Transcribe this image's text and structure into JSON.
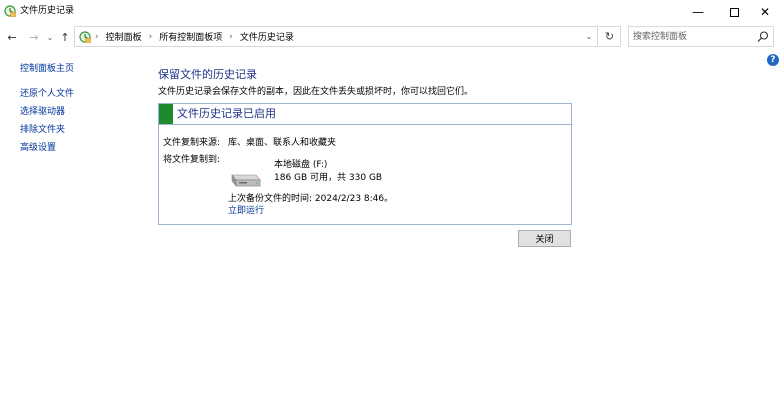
{
  "window": {
    "title": "文件历史记录",
    "minimize_glyph": "—",
    "close_glyph": "✕"
  },
  "nav": {
    "back_glyph": "←",
    "forward_glyph": "→",
    "history_glyph": "⌄",
    "up_glyph": "↑",
    "dropdown_glyph": "⌄",
    "refresh_glyph": "↻",
    "separator": "›"
  },
  "breadcrumb": {
    "items": [
      "控制面板",
      "所有控制面板项",
      "文件历史记录"
    ]
  },
  "search": {
    "placeholder": "搜索控制面板"
  },
  "help": {
    "glyph": "?"
  },
  "sidebar": {
    "items": [
      {
        "label": "控制面板主页"
      },
      {
        "label": "还原个人文件"
      },
      {
        "label": "选择驱动器"
      },
      {
        "label": "排除文件夹"
      },
      {
        "label": "高级设置"
      }
    ]
  },
  "main": {
    "title": "保留文件的历史记录",
    "description": "文件历史记录会保存文件的副本，因此在文件丢失或损坏时，你可以找回它们。"
  },
  "panel": {
    "status_title": "文件历史记录已启用",
    "copy_from_label": "文件复制来源:",
    "copy_from_value": "库、桌面、联系人和收藏夹",
    "copy_to_label": "将文件复制到:",
    "drive_name": "本地磁盘 (F:)",
    "drive_space": "186 GB 可用，共 330 GB",
    "last_backup": "上次备份文件的时间: 2024/2/23 8:46。",
    "run_now": "立即运行"
  },
  "buttons": {
    "close": "关闭"
  },
  "colors": {
    "status_green": "#1d8a2e",
    "link_blue": "#003399",
    "heading_blue": "#1e3287",
    "panel_border": "#a0b4d0"
  }
}
